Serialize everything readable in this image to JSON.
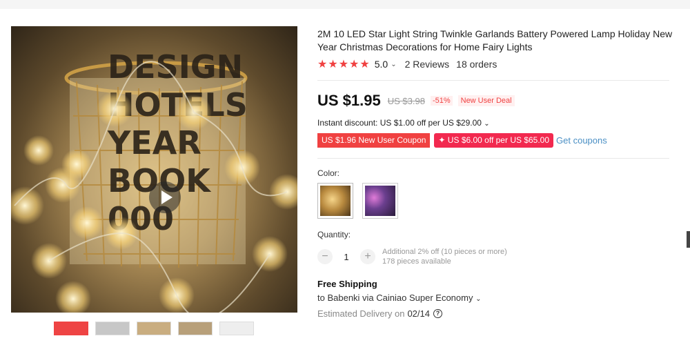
{
  "product": {
    "title": "2M 10 LED Star Light String Twinkle Garlands Battery Powered Lamp Holiday New Year Christmas Decorations for Home Fairy Lights",
    "rating": {
      "stars": "★★★★★",
      "score": "5.0",
      "reviews": "2 Reviews",
      "orders": "18 orders"
    },
    "price": {
      "current": "US $1.95",
      "original": "US $3.98",
      "discount": "-51%",
      "deal": "New User Deal"
    },
    "instant_discount": "Instant discount: US $1.00 off per US $29.00",
    "coupons": {
      "coupon1": "US $1.96 New User Coupon",
      "coupon2": "✦ US $6.00 off per US $65.00",
      "get": "Get coupons"
    },
    "color": {
      "label": "Color:"
    },
    "quantity": {
      "label": "Quantity:",
      "minus": "−",
      "value": "1",
      "plus": "+",
      "note1": "Additional 2% off (10 pieces or more)",
      "note2": "178 pieces available"
    },
    "shipping": {
      "title": "Free Shipping",
      "to": "to Babenki via Cainiao Super Economy",
      "est_label": "Estimated Delivery on",
      "est_date": "02/14",
      "help": "?"
    }
  },
  "icons": {
    "play": "play-icon",
    "chevron": "chevron-down-icon",
    "help": "help-circle-icon"
  },
  "colors": {
    "accent": "#f04141",
    "link": "#4a8fc4"
  }
}
